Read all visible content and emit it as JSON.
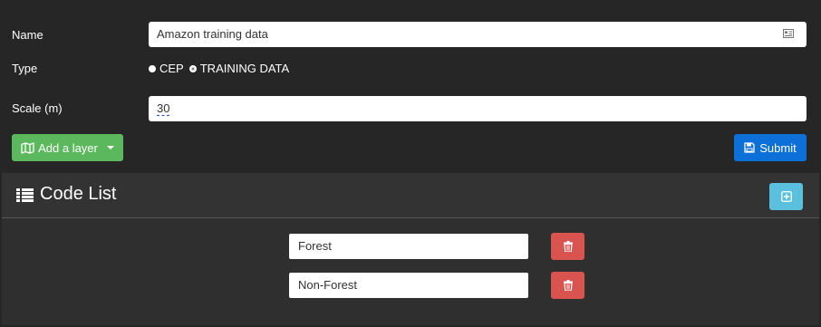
{
  "form": {
    "name_label": "Name",
    "name_value": "Amazon training data",
    "type_label": "Type",
    "type_options": [
      {
        "label": "CEP",
        "checked": false
      },
      {
        "label": "TRAINING DATA",
        "checked": true
      }
    ],
    "scale_label": "Scale (m)",
    "scale_value": "30",
    "add_layer_label": "Add a layer",
    "submit_label": "Submit"
  },
  "code_list": {
    "title": "Code List",
    "codes": [
      {
        "value": "Forest"
      },
      {
        "value": "Non-Forest"
      }
    ]
  },
  "colors": {
    "background": "#262626",
    "add_layer_button": "#5cb85c",
    "submit_button": "#0d6fd8",
    "add_code_button": "#5bc0de",
    "delete_button": "#d9534f"
  },
  "icons": {
    "name_field": "id-card-icon",
    "add_layer": "map-icon",
    "submit": "save-icon",
    "code_list": "list-icon",
    "add_code": "plus-square-icon",
    "delete_code": "trash-icon"
  }
}
